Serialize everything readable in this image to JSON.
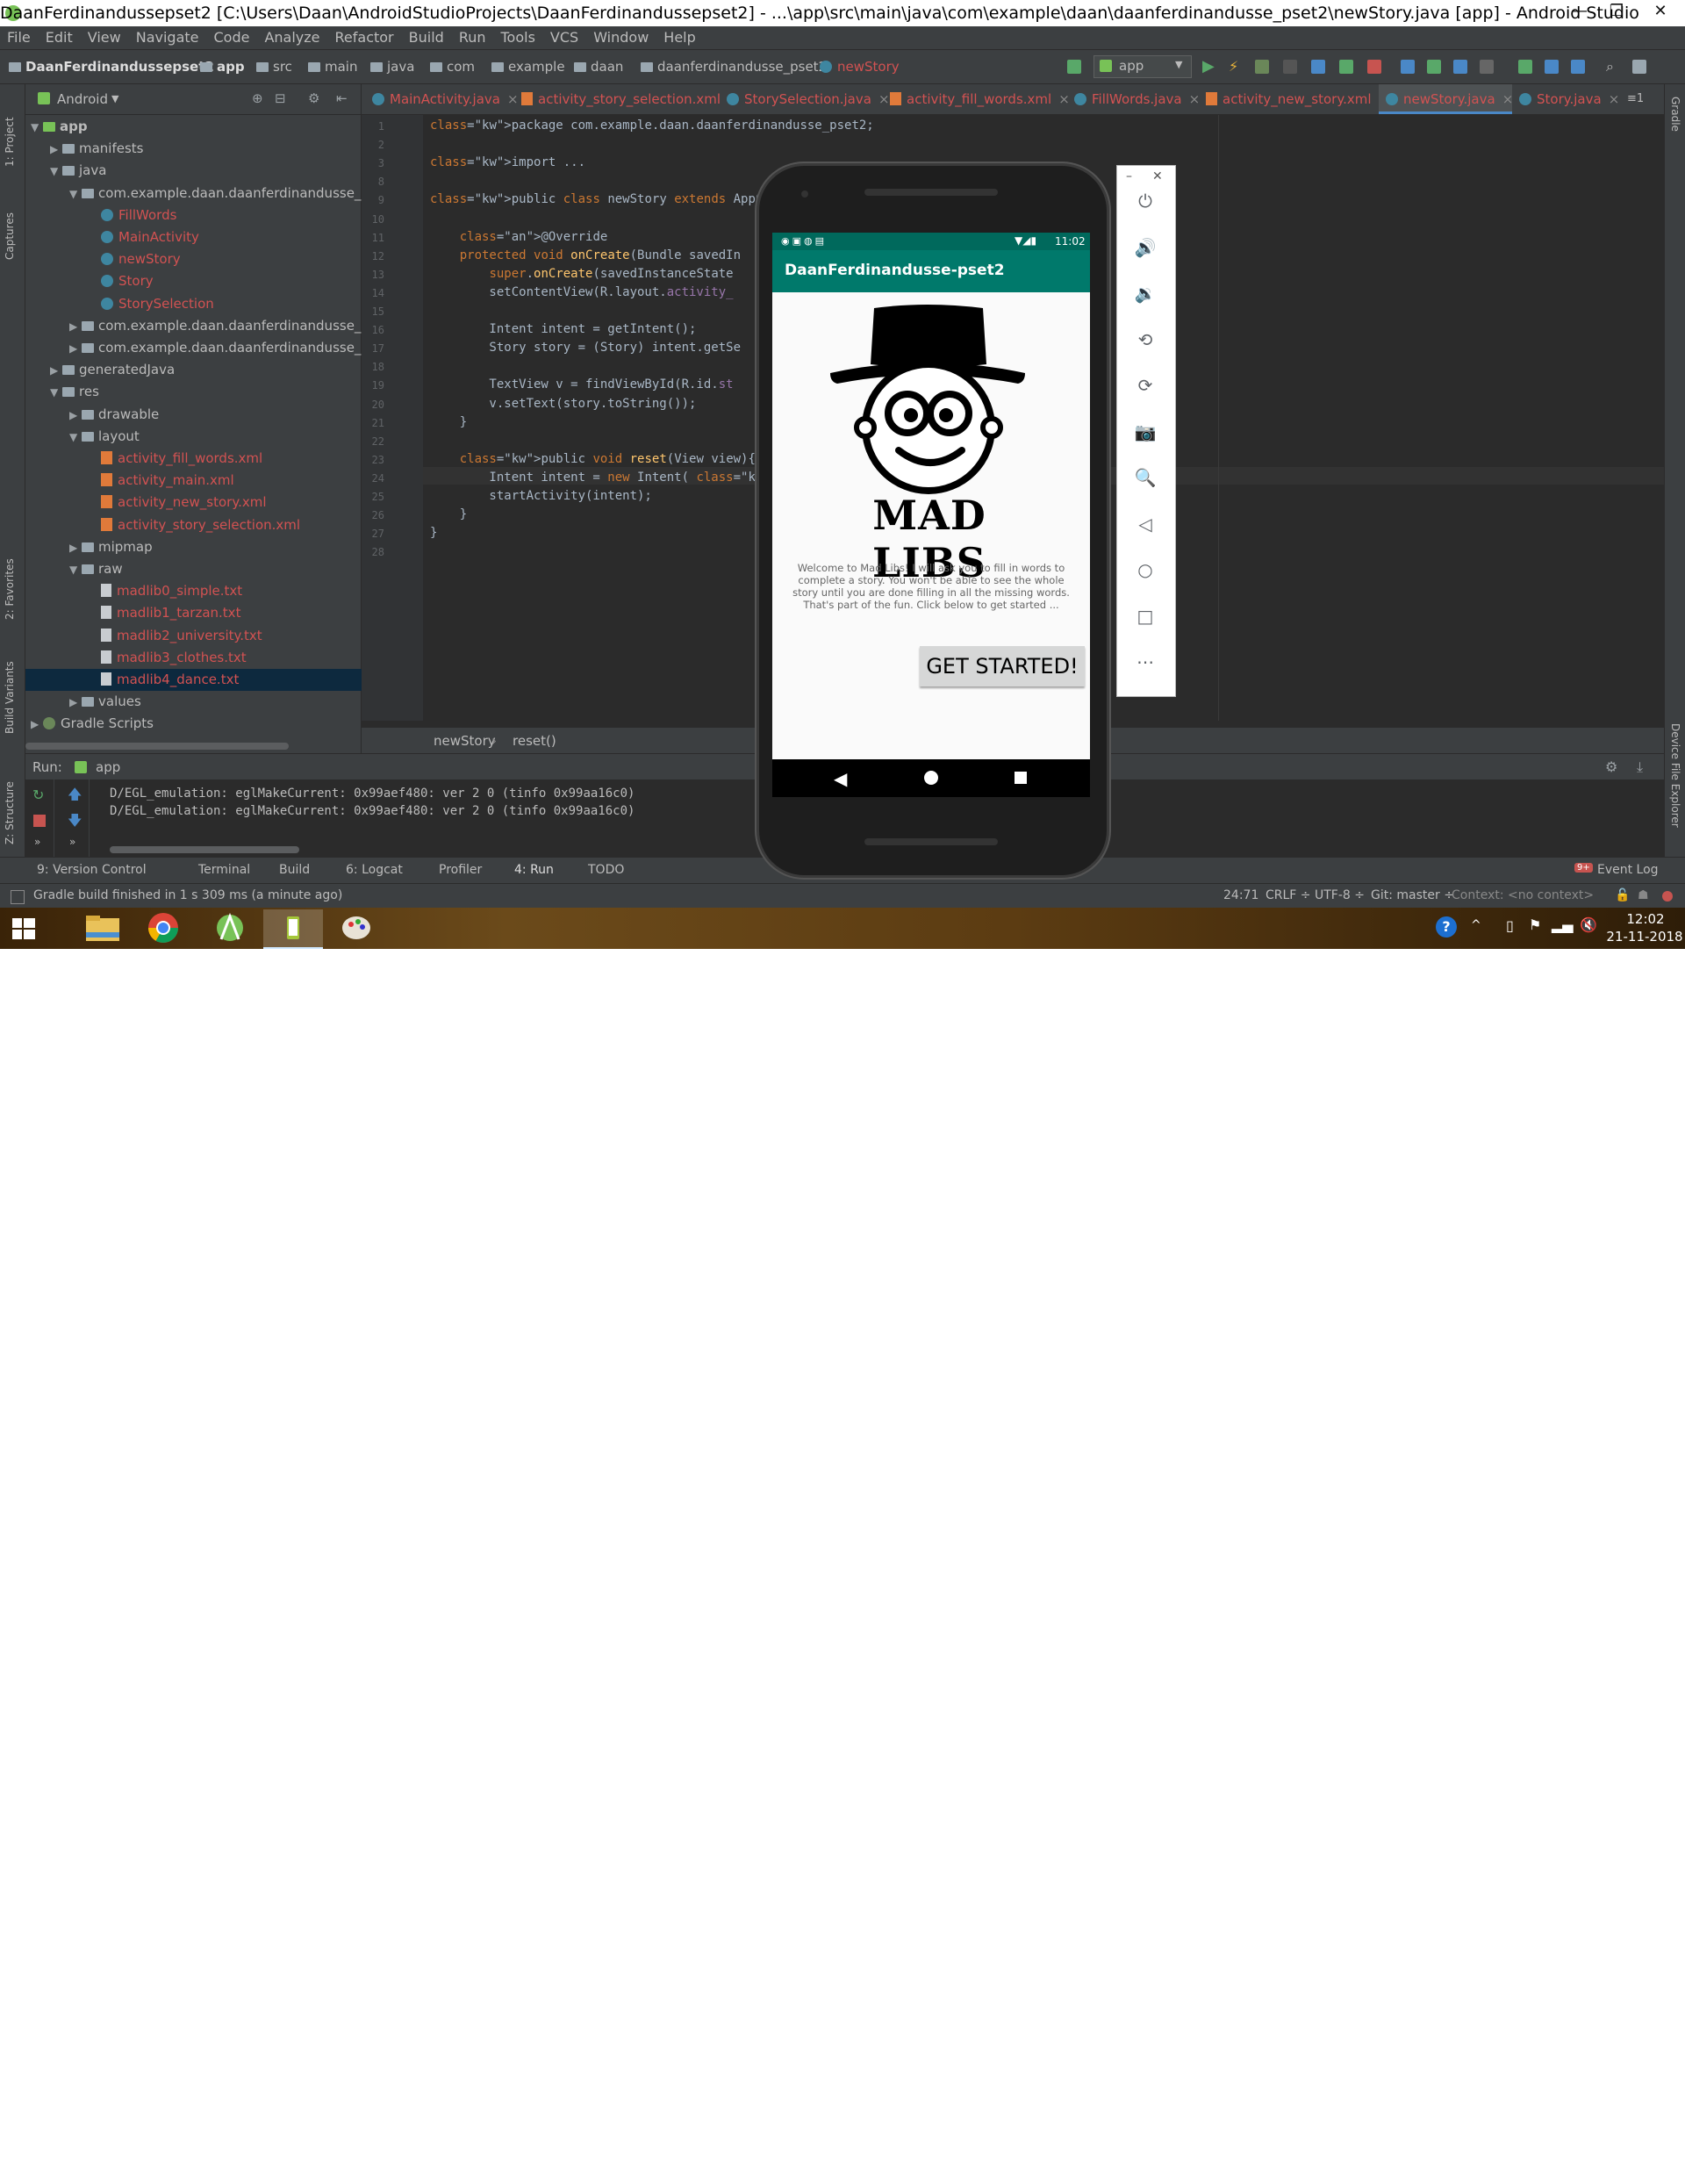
{
  "window": {
    "title": "DaanFerdinandussepset2 [C:\\Users\\Daan\\AndroidStudioProjects\\DaanFerdinandussepset2] - ...\\app\\src\\main\\java\\com\\example\\daan\\daanferdinandusse_pset2\\newStory.java [app] - Android Studio",
    "minimize": "—",
    "maximize": "❐",
    "close": "✕"
  },
  "menu": [
    "File",
    "Edit",
    "View",
    "Navigate",
    "Code",
    "Analyze",
    "Refactor",
    "Build",
    "Run",
    "Tools",
    "VCS",
    "Window",
    "Help"
  ],
  "breadcrumbs": [
    "DaanFerdinandussepset2",
    "app",
    "src",
    "main",
    "java",
    "com",
    "example",
    "daan",
    "daanferdinandusse_pset2",
    "newStory"
  ],
  "run_config": "app",
  "project_panel": {
    "view_mode": "Android",
    "tree": [
      {
        "label": "app",
        "depth": 0,
        "arrow": "▼",
        "type": "module"
      },
      {
        "label": "manifests",
        "depth": 1,
        "arrow": "▶",
        "type": "folder"
      },
      {
        "label": "java",
        "depth": 1,
        "arrow": "▼",
        "type": "folder"
      },
      {
        "label": "com.example.daan.daanferdinandusse_pset",
        "depth": 2,
        "arrow": "▼",
        "type": "package"
      },
      {
        "label": "FillWords",
        "depth": 3,
        "arrow": "",
        "type": "class",
        "red": true
      },
      {
        "label": "MainActivity",
        "depth": 3,
        "arrow": "",
        "type": "class",
        "red": true
      },
      {
        "label": "newStory",
        "depth": 3,
        "arrow": "",
        "type": "class",
        "red": true
      },
      {
        "label": "Story",
        "depth": 3,
        "arrow": "",
        "type": "class",
        "red": true
      },
      {
        "label": "StorySelection",
        "depth": 3,
        "arrow": "",
        "type": "class",
        "red": true
      },
      {
        "label": "com.example.daan.daanferdinandusse_pset",
        "depth": 2,
        "arrow": "▶",
        "type": "package"
      },
      {
        "label": "com.example.daan.daanferdinandusse_pset",
        "depth": 2,
        "arrow": "▶",
        "type": "package"
      },
      {
        "label": "generatedJava",
        "depth": 1,
        "arrow": "▶",
        "type": "folder"
      },
      {
        "label": "res",
        "depth": 1,
        "arrow": "▼",
        "type": "folder"
      },
      {
        "label": "drawable",
        "depth": 2,
        "arrow": "▶",
        "type": "folder"
      },
      {
        "label": "layout",
        "depth": 2,
        "arrow": "▼",
        "type": "folder"
      },
      {
        "label": "activity_fill_words.xml",
        "depth": 3,
        "arrow": "",
        "type": "xml",
        "red": true
      },
      {
        "label": "activity_main.xml",
        "depth": 3,
        "arrow": "",
        "type": "xml",
        "red": true
      },
      {
        "label": "activity_new_story.xml",
        "depth": 3,
        "arrow": "",
        "type": "xml",
        "red": true
      },
      {
        "label": "activity_story_selection.xml",
        "depth": 3,
        "arrow": "",
        "type": "xml",
        "red": true
      },
      {
        "label": "mipmap",
        "depth": 2,
        "arrow": "▶",
        "type": "folder"
      },
      {
        "label": "raw",
        "depth": 2,
        "arrow": "▼",
        "type": "folder"
      },
      {
        "label": "madlib0_simple.txt",
        "depth": 3,
        "arrow": "",
        "type": "txt",
        "red": true
      },
      {
        "label": "madlib1_tarzan.txt",
        "depth": 3,
        "arrow": "",
        "type": "txt",
        "red": true
      },
      {
        "label": "madlib2_university.txt",
        "depth": 3,
        "arrow": "",
        "type": "txt",
        "red": true
      },
      {
        "label": "madlib3_clothes.txt",
        "depth": 3,
        "arrow": "",
        "type": "txt",
        "red": true
      },
      {
        "label": "madlib4_dance.txt",
        "depth": 3,
        "arrow": "",
        "type": "txt",
        "red": true,
        "selected": true
      },
      {
        "label": "values",
        "depth": 2,
        "arrow": "▶",
        "type": "folder"
      },
      {
        "label": "Gradle Scripts",
        "depth": 0,
        "arrow": "▶",
        "type": "gradle"
      }
    ]
  },
  "left_strip": [
    "1: Project",
    "Captures",
    "2: Favorites",
    "Build Variants",
    "Z: Structure"
  ],
  "right_strip": [
    "Gradle",
    "Device File Explorer"
  ],
  "tabs": [
    {
      "label": "MainActivity.java",
      "kind": "class"
    },
    {
      "label": "activity_story_selection.xml",
      "kind": "xml"
    },
    {
      "label": "StorySelection.java",
      "kind": "class"
    },
    {
      "label": "activity_fill_words.xml",
      "kind": "xml"
    },
    {
      "label": "FillWords.java",
      "kind": "class"
    },
    {
      "label": "activity_new_story.xml",
      "kind": "xml"
    },
    {
      "label": "newStory.java",
      "kind": "class",
      "active": true
    },
    {
      "label": "Story.java",
      "kind": "class"
    }
  ],
  "tabs_overflow": "≡1",
  "code_lines": [
    {
      "n": "1",
      "text": "package com.example.daan.daanferdinandusse_pset2;"
    },
    {
      "n": "2",
      "text": ""
    },
    {
      "n": "3",
      "text": "import ..."
    },
    {
      "n": "8",
      "text": ""
    },
    {
      "n": "9",
      "text": "public class newStory extends AppCompatAct"
    },
    {
      "n": "10",
      "text": ""
    },
    {
      "n": "11",
      "text": "    @Override"
    },
    {
      "n": "12",
      "text": "    protected void onCreate(Bundle savedIn"
    },
    {
      "n": "13",
      "text": "        super.onCreate(savedInstanceState"
    },
    {
      "n": "14",
      "text": "        setContentView(R.layout.activity_"
    },
    {
      "n": "15",
      "text": ""
    },
    {
      "n": "16",
      "text": "        Intent intent = getIntent();"
    },
    {
      "n": "17",
      "text": "        Story story = (Story) intent.getSe"
    },
    {
      "n": "18",
      "text": ""
    },
    {
      "n": "19",
      "text": "        TextView v = findViewById(R.id.st"
    },
    {
      "n": "20",
      "text": "        v.setText(story.toString());"
    },
    {
      "n": "21",
      "text": "    }"
    },
    {
      "n": "22",
      "text": ""
    },
    {
      "n": "23",
      "text": "    public void reset(View view){"
    },
    {
      "n": "24",
      "text": "        Intent intent = new Intent( package"
    },
    {
      "n": "25",
      "text": "        startActivity(intent);"
    },
    {
      "n": "26",
      "text": "    }"
    },
    {
      "n": "27",
      "text": "}"
    },
    {
      "n": "28",
      "text": ""
    }
  ],
  "editor_breadcrumb": [
    "newStory",
    "reset()"
  ],
  "run_panel": {
    "label": "Run:",
    "config": "app",
    "logs": [
      "D/EGL_emulation: eglMakeCurrent: 0x99aef480: ver 2 0 (tinfo 0x99aa16c0)",
      "D/EGL_emulation: eglMakeCurrent: 0x99aef480: ver 2 0 (tinfo 0x99aa16c0)"
    ]
  },
  "bottom_tools": [
    "9: Version Control",
    "Terminal",
    "Build",
    "6: Logcat",
    "Profiler",
    "4: Run",
    "TODO"
  ],
  "event_log": "Event Log",
  "event_count": "9+",
  "status": {
    "message": "Gradle build finished in 1 s 309 ms (a minute ago)",
    "position": "24:71",
    "line_sep": "CRLF ÷",
    "encoding": "UTF-8 ÷",
    "git": "Git: master ÷",
    "context": "Context: <no context>"
  },
  "taskbar": {
    "time": "12:02",
    "date": "21-11-2018"
  },
  "emulator": {
    "clock": "11:02",
    "app_title": "DaanFerdinandusse-pset2",
    "logo_text": "MAD LIBS",
    "welcome": "Welcome to Mad Libs! I will ask you to fill in words to complete a story. You won't be able to see the whole story until you are done filling in all the missing words. That's part of the fun. Click below to get started ...",
    "button": "GET STARTED!",
    "side_controls": [
      "power-icon",
      "volume-up-icon",
      "volume-down-icon",
      "rotate-left-icon",
      "rotate-right-icon",
      "camera-icon",
      "zoom-icon",
      "back-icon",
      "home-icon",
      "overview-icon",
      "more-icon"
    ],
    "side_min": "–",
    "side_close": "✕"
  },
  "colors": {
    "ide_bg": "#2b2b2b",
    "panel_bg": "#3c3f41",
    "app_primary": "#00796b",
    "keyword": "#cc7832"
  }
}
